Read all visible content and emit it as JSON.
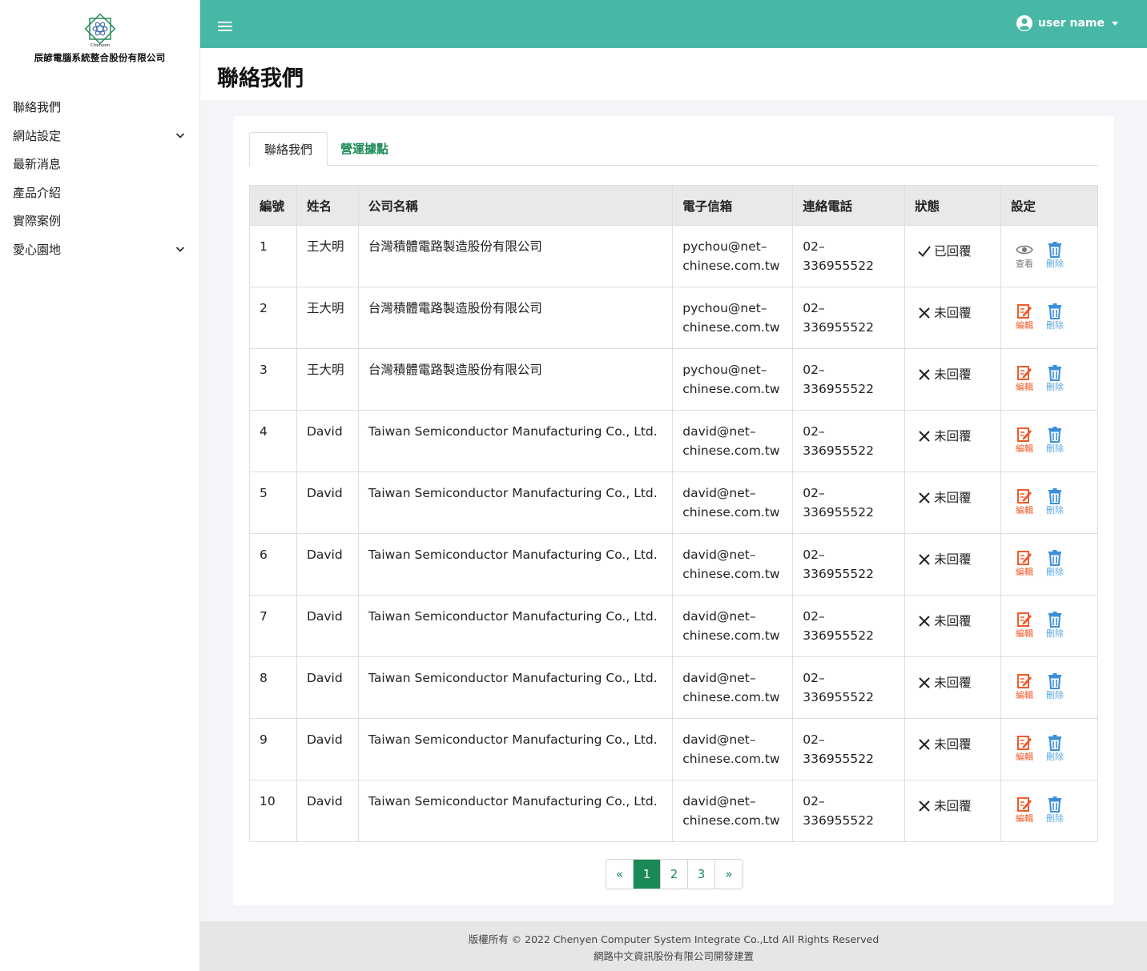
{
  "company": {
    "name": "辰諺電腦系統整合股份有限公司",
    "logo_text": "Chenyen"
  },
  "sidebar": {
    "items": [
      {
        "label": "聯絡我們",
        "has_children": false
      },
      {
        "label": "網站設定",
        "has_children": true
      },
      {
        "label": "最新消息",
        "has_children": false
      },
      {
        "label": "產品介紹",
        "has_children": false
      },
      {
        "label": "實際案例",
        "has_children": false
      },
      {
        "label": "愛心園地",
        "has_children": true
      }
    ]
  },
  "topbar": {
    "user": "user name",
    "accent": "#48b8a6"
  },
  "page": {
    "title": "聯絡我們"
  },
  "tabs": [
    {
      "label": "聯絡我們",
      "active": true
    },
    {
      "label": "營運據點",
      "active": false
    }
  ],
  "table": {
    "headers": [
      "編號",
      "姓名",
      "公司名稱",
      "電子信箱",
      "連絡電話",
      "狀態",
      "設定"
    ],
    "rows": [
      {
        "id": "1",
        "name": "王大明",
        "company": "台灣積體電路製造股份有限公司",
        "email": [
          "pychou@net–",
          "chinese.com.tw"
        ],
        "phone": [
          "02–",
          "336955522"
        ],
        "status": "已回覆",
        "replied": true
      },
      {
        "id": "2",
        "name": "王大明",
        "company": "台灣積體電路製造股份有限公司",
        "email": [
          "pychou@net–",
          "chinese.com.tw"
        ],
        "phone": [
          "02–",
          "336955522"
        ],
        "status": "未回覆",
        "replied": false
      },
      {
        "id": "3",
        "name": "王大明",
        "company": "台灣積體電路製造股份有限公司",
        "email": [
          "pychou@net–",
          "chinese.com.tw"
        ],
        "phone": [
          "02–",
          "336955522"
        ],
        "status": "未回覆",
        "replied": false
      },
      {
        "id": "4",
        "name": "David",
        "company": "Taiwan Semiconductor Manufacturing Co., Ltd.",
        "email": [
          "david@net–",
          "chinese.com.tw"
        ],
        "phone": [
          "02–",
          "336955522"
        ],
        "status": "未回覆",
        "replied": false
      },
      {
        "id": "5",
        "name": "David",
        "company": "Taiwan Semiconductor Manufacturing Co., Ltd.",
        "email": [
          "david@net–",
          "chinese.com.tw"
        ],
        "phone": [
          "02–",
          "336955522"
        ],
        "status": "未回覆",
        "replied": false
      },
      {
        "id": "6",
        "name": "David",
        "company": "Taiwan Semiconductor Manufacturing Co., Ltd.",
        "email": [
          "david@net–",
          "chinese.com.tw"
        ],
        "phone": [
          "02–",
          "336955522"
        ],
        "status": "未回覆",
        "replied": false
      },
      {
        "id": "7",
        "name": "David",
        "company": "Taiwan Semiconductor Manufacturing Co., Ltd.",
        "email": [
          "david@net–",
          "chinese.com.tw"
        ],
        "phone": [
          "02–",
          "336955522"
        ],
        "status": "未回覆",
        "replied": false
      },
      {
        "id": "8",
        "name": "David",
        "company": "Taiwan Semiconductor Manufacturing Co., Ltd.",
        "email": [
          "david@net–",
          "chinese.com.tw"
        ],
        "phone": [
          "02–",
          "336955522"
        ],
        "status": "未回覆",
        "replied": false
      },
      {
        "id": "9",
        "name": "David",
        "company": "Taiwan Semiconductor Manufacturing Co., Ltd.",
        "email": [
          "david@net–",
          "chinese.com.tw"
        ],
        "phone": [
          "02–",
          "336955522"
        ],
        "status": "未回覆",
        "replied": false
      },
      {
        "id": "10",
        "name": "David",
        "company": "Taiwan Semiconductor Manufacturing Co., Ltd.",
        "email": [
          "david@net–",
          "chinese.com.tw"
        ],
        "phone": [
          "02–",
          "336955522"
        ],
        "status": "未回覆",
        "replied": false
      }
    ],
    "actions": {
      "view": "查看",
      "edit": "編輯",
      "delete": "刪除"
    }
  },
  "pagination": {
    "prev": "«",
    "pages": [
      "1",
      "2",
      "3"
    ],
    "current": "1",
    "next": "»"
  },
  "footer": {
    "line1": "版權所有 © 2022 Chenyen Computer System Integrate Co.,Ltd All Rights Reserved",
    "line2": "網路中文資訊股份有限公司開發建置"
  }
}
